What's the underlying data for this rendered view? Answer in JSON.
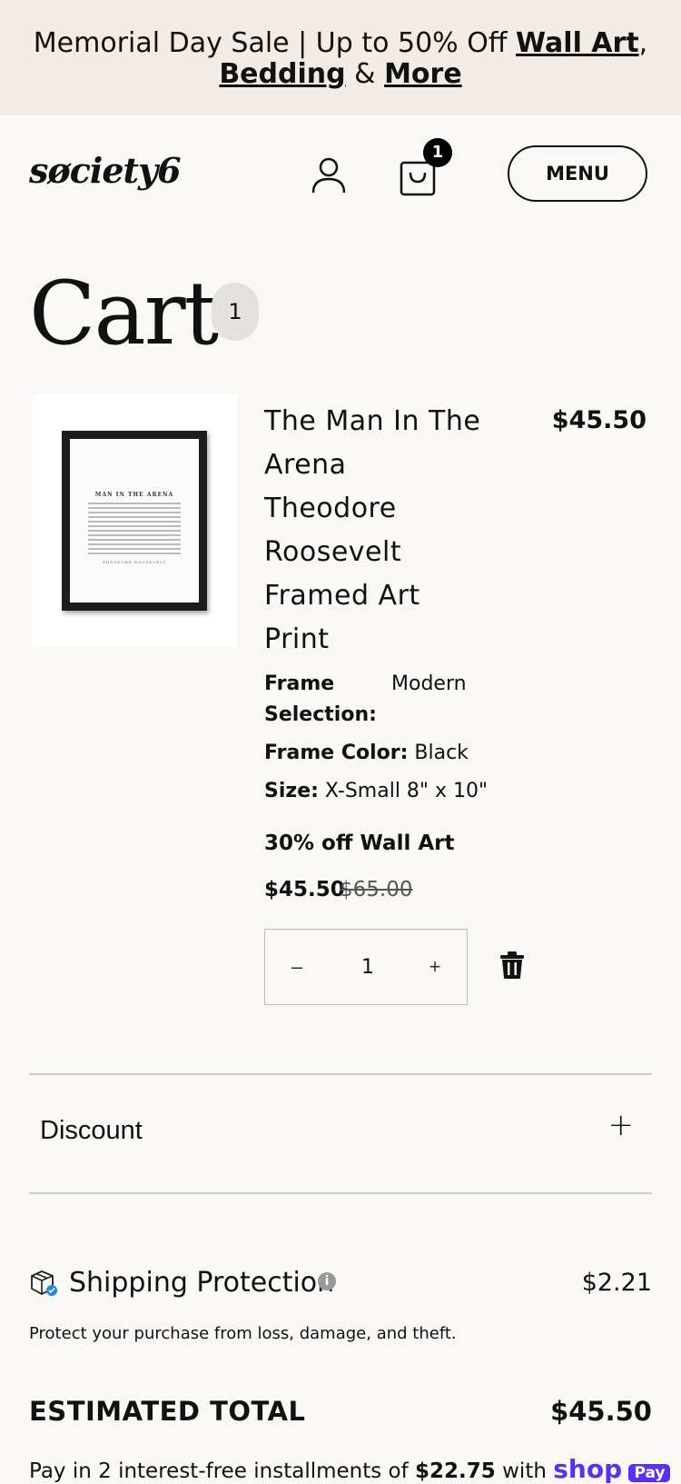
{
  "banner": {
    "prefix": "Memorial Day Sale | Up to 50% Off ",
    "link_wall_art": "Wall Art",
    "comma": ",",
    "link_bedding": "Bedding",
    "ampersand": " & ",
    "link_more": "More"
  },
  "header": {
    "logo": "søciety6",
    "cart_count": "1",
    "menu_label": "MENU"
  },
  "page": {
    "title": "Cart",
    "item_count": "1"
  },
  "item": {
    "image_print_title": "MAN IN THE ARENA",
    "image_print_author": "THEODORE ROOSEVELT",
    "name": "The Man In The Arena Theodore Roosevelt Framed Art Print",
    "price": "$45.50",
    "attributes": [
      {
        "label": "Frame Selection:",
        "value": "Modern"
      },
      {
        "label": "Frame Color:",
        "value": "Black"
      },
      {
        "label": "Size:",
        "value": "X-Small 8\" x 10\""
      }
    ],
    "promo": "30% off Wall Art",
    "sale_price": "$45.50",
    "original_price": "$65.00",
    "quantity": "1",
    "minus_label": "–",
    "plus_label": "+"
  },
  "discount": {
    "label": "Discount",
    "toggle": "+"
  },
  "shipping_protection": {
    "label": "Shipping Protection",
    "info": "i",
    "price": "$2.21",
    "description": "Protect your purchase from loss, damage, and theft."
  },
  "totals": {
    "label": "ESTIMATED TOTAL",
    "value": "$45.50",
    "installments_prefix": "Pay in 2 interest-free installments of ",
    "installment_amount": "$22.75",
    "installments_with": " with ",
    "shop_word": "shop",
    "pay_word": "Pay"
  }
}
